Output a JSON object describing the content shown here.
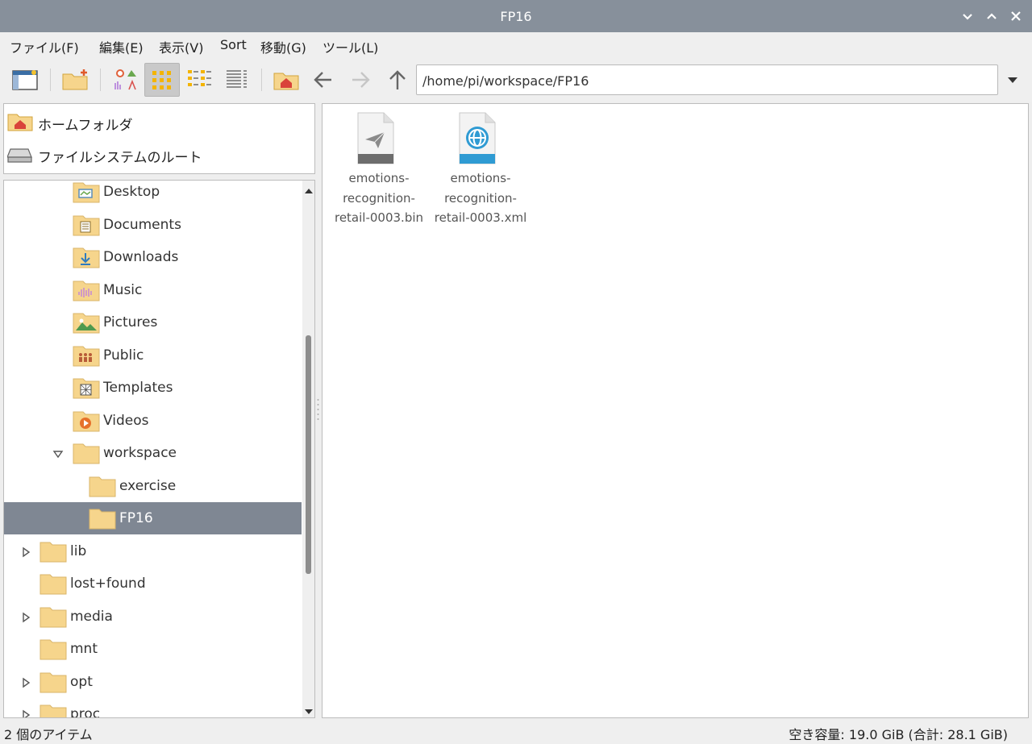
{
  "window": {
    "title": "FP16"
  },
  "menu": [
    {
      "label": "ファイル(F)"
    },
    {
      "label": "編集(E)"
    },
    {
      "label": "表示(V)"
    },
    {
      "label": "Sort"
    },
    {
      "label": "移動(G)"
    },
    {
      "label": "ツール(L)"
    }
  ],
  "toolbar": {
    "path": "/home/pi/workspace/FP16",
    "active_view": "icon-view"
  },
  "places": [
    {
      "label": "ホームフォルダ",
      "icon": "home-folder-icon"
    },
    {
      "label": "ファイルシステムのルート",
      "icon": "drive-icon"
    }
  ],
  "tree": [
    {
      "label": "Desktop",
      "icon": "desktop-folder-icon",
      "depth": 2,
      "expander": "none",
      "selected": false
    },
    {
      "label": "Documents",
      "icon": "documents-folder-icon",
      "depth": 2,
      "expander": "none",
      "selected": false
    },
    {
      "label": "Downloads",
      "icon": "downloads-folder-icon",
      "depth": 2,
      "expander": "none",
      "selected": false
    },
    {
      "label": "Music",
      "icon": "music-folder-icon",
      "depth": 2,
      "expander": "none",
      "selected": false
    },
    {
      "label": "Pictures",
      "icon": "pictures-folder-icon",
      "depth": 2,
      "expander": "none",
      "selected": false
    },
    {
      "label": "Public",
      "icon": "public-folder-icon",
      "depth": 2,
      "expander": "none",
      "selected": false
    },
    {
      "label": "Templates",
      "icon": "templates-folder-icon",
      "depth": 2,
      "expander": "none",
      "selected": false
    },
    {
      "label": "Videos",
      "icon": "videos-folder-icon",
      "depth": 2,
      "expander": "none",
      "selected": false
    },
    {
      "label": "workspace",
      "icon": "folder-icon",
      "depth": 2,
      "expander": "expanded",
      "selected": false
    },
    {
      "label": "exercise",
      "icon": "folder-icon",
      "depth": 3,
      "expander": "none",
      "selected": false
    },
    {
      "label": "FP16",
      "icon": "folder-icon",
      "depth": 3,
      "expander": "none",
      "selected": true
    },
    {
      "label": "lib",
      "icon": "folder-icon",
      "depth": 1,
      "expander": "collapsed",
      "selected": false
    },
    {
      "label": "lost+found",
      "icon": "folder-icon",
      "depth": 1,
      "expander": "none",
      "selected": false
    },
    {
      "label": "media",
      "icon": "folder-icon",
      "depth": 1,
      "expander": "collapsed",
      "selected": false
    },
    {
      "label": "mnt",
      "icon": "folder-icon",
      "depth": 1,
      "expander": "none",
      "selected": false
    },
    {
      "label": "opt",
      "icon": "folder-icon",
      "depth": 1,
      "expander": "collapsed",
      "selected": false
    },
    {
      "label": "proc",
      "icon": "folder-icon",
      "depth": 1,
      "expander": "collapsed",
      "selected": false
    }
  ],
  "files": [
    {
      "name": "emotions-recognition-retail-0003.bin",
      "lines": [
        "emotions-",
        "recognition-",
        "retail-0003.bin"
      ],
      "icon": "binary-file-icon"
    },
    {
      "name": "emotions-recognition-retail-0003.xml",
      "lines": [
        "emotions-",
        "recognition-",
        "retail-0003.xml"
      ],
      "icon": "xml-file-icon"
    }
  ],
  "status": {
    "items": "2 個のアイテム",
    "free": "空き容量: 19.0 GiB (合計: 28.1 GiB)"
  },
  "colors": {
    "titlebar": "#87909b",
    "selection": "#7f8793",
    "folder": "#f6d58c",
    "xml_accent": "#2f9bd3"
  }
}
